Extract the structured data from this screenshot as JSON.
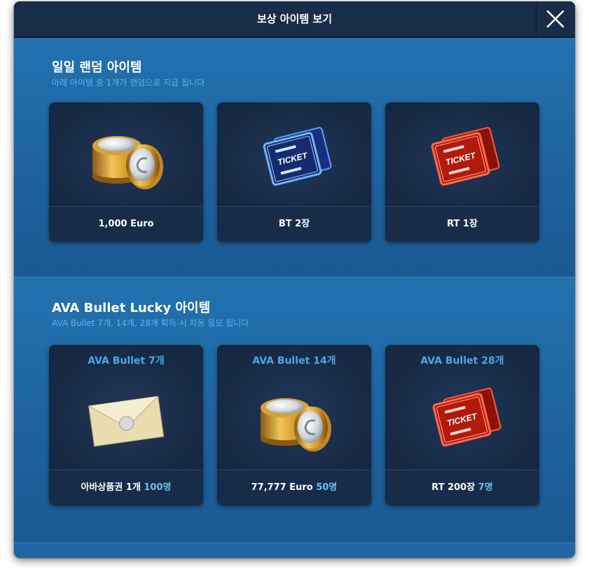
{
  "modal": {
    "title": "보상 아이템 보기",
    "close_icon": "close-icon"
  },
  "daily": {
    "title": "일일 랜덤 아이템",
    "subtitle": "아래 아이템 중 1개가 랜덤으로 지급 됩니다",
    "items": [
      {
        "label": "1,000 Euro",
        "icon": "euro-coins-icon"
      },
      {
        "label": "BT 2장",
        "icon": "blue-ticket-icon",
        "ticket_text": "TICKET"
      },
      {
        "label": "RT 1장",
        "icon": "red-ticket-icon",
        "ticket_text": "TICKET"
      }
    ]
  },
  "lucky": {
    "title": "AVA Bullet Lucky 아이템",
    "subtitle": "AVA Bullet 7개, 14개, 28개 획득 시 자동 응모 됩니다",
    "items": [
      {
        "count_title": "AVA Bullet 7개",
        "label": "아바상품권 1개",
        "winners": "100명",
        "icon": "envelope-icon"
      },
      {
        "count_title": "AVA Bullet 14개",
        "label": "77,777 Euro",
        "winners": "50명",
        "icon": "euro-coins-icon"
      },
      {
        "count_title": "AVA Bullet 28개",
        "label": "RT 200장",
        "winners": "7명",
        "icon": "red-ticket-icon",
        "ticket_text": "TICKET"
      }
    ]
  },
  "colors": {
    "accent": "#4aa8e6",
    "panel": "#1d5f99",
    "header": "#182d47",
    "card": "#172a44"
  }
}
